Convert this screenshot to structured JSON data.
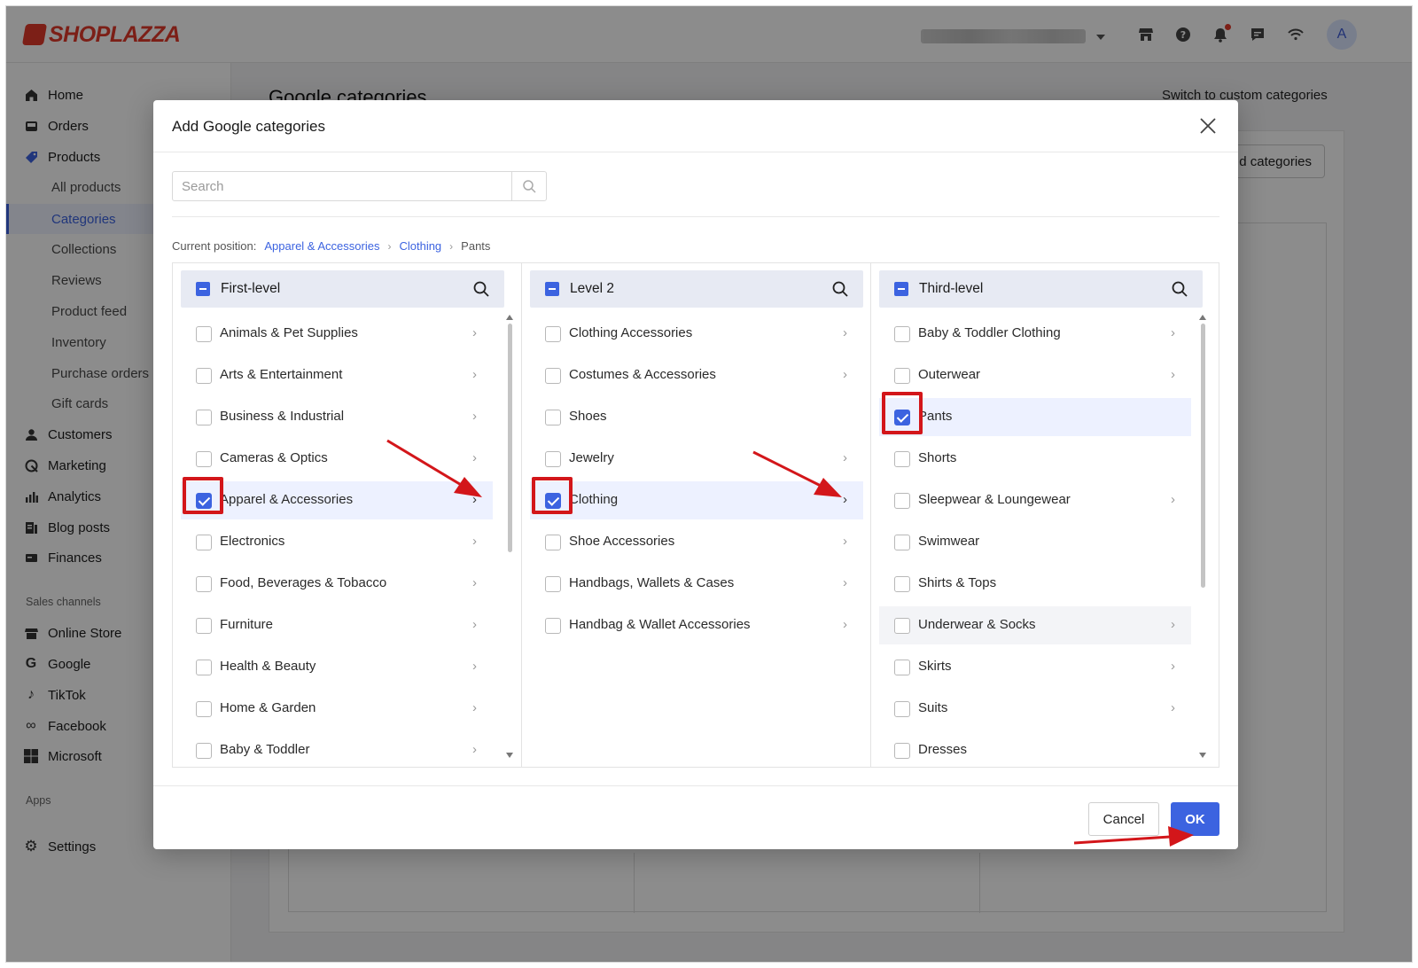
{
  "brand": {
    "logo_text": "SHOPLAZZA",
    "logo_color": "#e23a2a"
  },
  "topbar": {
    "icons": [
      "store-icon",
      "help-icon",
      "bell-icon",
      "message-icon",
      "wifi-icon"
    ],
    "avatar_initial": "A"
  },
  "sidebar": {
    "items": [
      {
        "label": "Home",
        "icon": "home-icon"
      },
      {
        "label": "Orders",
        "icon": "orders-icon"
      },
      {
        "label": "Products",
        "icon": "tag-icon"
      },
      {
        "label": "All products"
      },
      {
        "label": "Categories"
      },
      {
        "label": "Collections"
      },
      {
        "label": "Reviews"
      },
      {
        "label": "Product feed"
      },
      {
        "label": "Inventory"
      },
      {
        "label": "Purchase orders"
      },
      {
        "label": "Gift cards"
      },
      {
        "label": "Customers",
        "icon": "person-icon"
      },
      {
        "label": "Marketing",
        "icon": "marketing-icon"
      },
      {
        "label": "Analytics",
        "icon": "analytics-icon"
      },
      {
        "label": "Blog posts",
        "icon": "blog-icon"
      },
      {
        "label": "Finances",
        "icon": "finances-icon"
      }
    ],
    "sales_channels_title": "Sales channels",
    "channels": [
      {
        "label": "Online Store",
        "icon": "store-icon"
      },
      {
        "label": "Google",
        "icon": "google-icon"
      },
      {
        "label": "TikTok",
        "icon": "tiktok-icon"
      },
      {
        "label": "Facebook",
        "icon": "meta-icon"
      },
      {
        "label": "Microsoft",
        "icon": "microsoft-icon"
      }
    ],
    "apps_title": "Apps",
    "settings_label": "Settings"
  },
  "main": {
    "title": "Google categories",
    "switch_link": "Switch to custom categories",
    "add_button_partial": "d categories"
  },
  "dialog": {
    "title": "Add Google categories",
    "search_placeholder": "Search",
    "breadcrumb": {
      "label": "Current position:",
      "path": [
        "Apparel & Accessories",
        "Clothing"
      ],
      "current": "Pants"
    },
    "columns": [
      {
        "header": "First-level",
        "items": [
          {
            "label": "Animals & Pet Supplies",
            "checked": false,
            "has_children": true
          },
          {
            "label": "Arts & Entertainment",
            "checked": false,
            "has_children": true
          },
          {
            "label": "Business & Industrial",
            "checked": false,
            "has_children": true
          },
          {
            "label": "Cameras & Optics",
            "checked": false,
            "has_children": true
          },
          {
            "label": "Apparel & Accessories",
            "checked": true,
            "has_children": true,
            "selected": true
          },
          {
            "label": "Electronics",
            "checked": false,
            "has_children": true
          },
          {
            "label": "Food, Beverages & Tobacco",
            "checked": false,
            "has_children": true
          },
          {
            "label": "Furniture",
            "checked": false,
            "has_children": true
          },
          {
            "label": "Health & Beauty",
            "checked": false,
            "has_children": true
          },
          {
            "label": "Home & Garden",
            "checked": false,
            "has_children": true
          },
          {
            "label": "Baby & Toddler",
            "checked": false,
            "has_children": true
          }
        ]
      },
      {
        "header": "Level 2",
        "items": [
          {
            "label": "Clothing Accessories",
            "checked": false,
            "has_children": true
          },
          {
            "label": "Costumes & Accessories",
            "checked": false,
            "has_children": true
          },
          {
            "label": "Shoes",
            "checked": false,
            "has_children": false
          },
          {
            "label": "Jewelry",
            "checked": false,
            "has_children": true
          },
          {
            "label": "Clothing",
            "checked": true,
            "has_children": true,
            "selected": true
          },
          {
            "label": "Shoe Accessories",
            "checked": false,
            "has_children": true
          },
          {
            "label": "Handbags, Wallets & Cases",
            "checked": false,
            "has_children": true
          },
          {
            "label": "Handbag & Wallet Accessories",
            "checked": false,
            "has_children": true
          }
        ]
      },
      {
        "header": "Third-level",
        "items": [
          {
            "label": "Baby & Toddler Clothing",
            "checked": false,
            "has_children": true
          },
          {
            "label": "Outerwear",
            "checked": false,
            "has_children": true
          },
          {
            "label": "Pants",
            "checked": true,
            "has_children": false,
            "selected": true
          },
          {
            "label": "Shorts",
            "checked": false,
            "has_children": false
          },
          {
            "label": "Sleepwear & Loungewear",
            "checked": false,
            "has_children": true
          },
          {
            "label": "Swimwear",
            "checked": false,
            "has_children": false
          },
          {
            "label": "Shirts & Tops",
            "checked": false,
            "has_children": false
          },
          {
            "label": "Underwear & Socks",
            "checked": false,
            "has_children": true,
            "hovered": true
          },
          {
            "label": "Skirts",
            "checked": false,
            "has_children": true
          },
          {
            "label": "Suits",
            "checked": false,
            "has_children": true
          },
          {
            "label": "Dresses",
            "checked": false,
            "has_children": false
          }
        ]
      }
    ],
    "cancel_label": "Cancel",
    "ok_label": "OK"
  },
  "colors": {
    "primary": "#3c63e0",
    "annotation": "#d3161a"
  }
}
